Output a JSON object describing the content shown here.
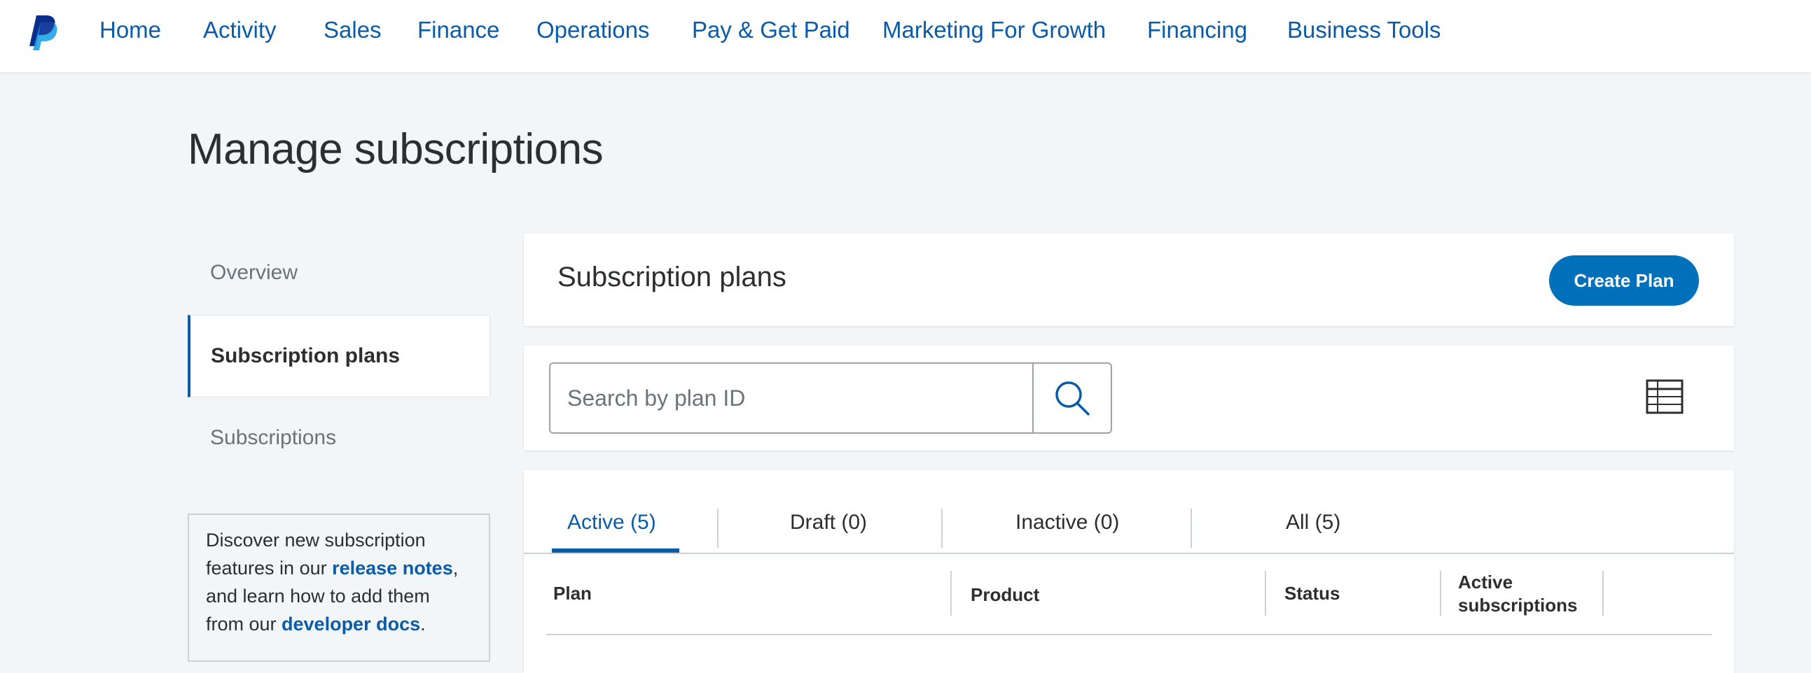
{
  "colors": {
    "brand": "#0070ba",
    "link": "#0a5ba8",
    "text": "#2c2e2f",
    "muted": "#6c7378",
    "background": "#f2f6f9"
  },
  "nav": {
    "logo_icon": "paypal-logo-icon",
    "items": [
      "Home",
      "Activity",
      "Sales",
      "Finance",
      "Operations",
      "Pay & Get Paid",
      "Marketing For Growth",
      "Financing",
      "Business Tools"
    ]
  },
  "page": {
    "title": "Manage subscriptions"
  },
  "sidebar": {
    "items": [
      {
        "label": "Overview",
        "active": false
      },
      {
        "label": "Subscription plans",
        "active": true
      },
      {
        "label": "Subscriptions",
        "active": false
      }
    ],
    "info": {
      "text_1": "Discover new subscription features in our ",
      "link_1": "release notes",
      "text_2": ", and learn how to add them from our ",
      "link_2": "developer docs",
      "text_3": "."
    }
  },
  "plans_card": {
    "title": "Subscription plans",
    "create_button": "Create Plan"
  },
  "search": {
    "placeholder": "Search by plan ID",
    "value": "",
    "search_icon": "search-icon",
    "view_icon": "table-view-icon"
  },
  "tabs": [
    {
      "label": "Active (5)",
      "active": true
    },
    {
      "label": "Draft (0)",
      "active": false
    },
    {
      "label": "Inactive (0)",
      "active": false
    },
    {
      "label": "All (5)",
      "active": false
    }
  ],
  "table": {
    "columns": [
      "Plan",
      "Product",
      "Status",
      "Active subscriptions"
    ]
  }
}
